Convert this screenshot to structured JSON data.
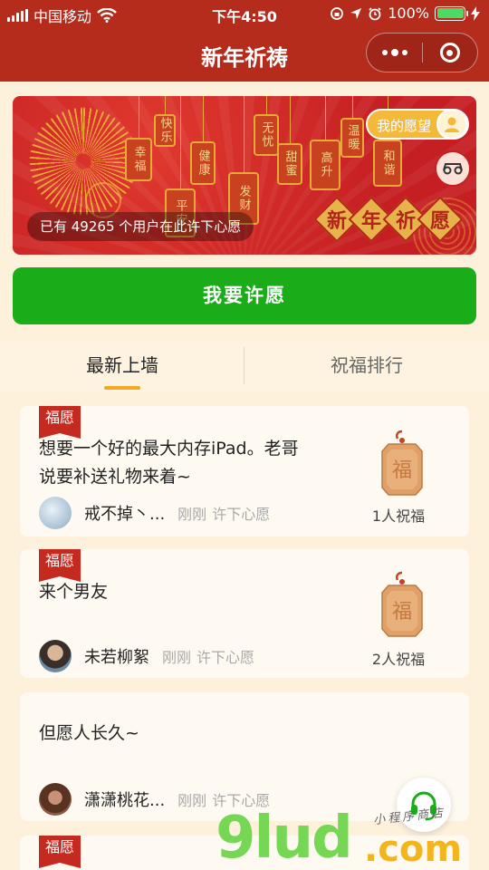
{
  "status_bar": {
    "carrier": "中国移动",
    "time": "下午4:50",
    "battery_percent": "100%",
    "battery_level": 1.0
  },
  "nav": {
    "title": "新年祈祷"
  },
  "banner": {
    "tags": [
      "快乐",
      "幸福",
      "健康",
      "平安",
      "发财",
      "无忧",
      "甜蜜",
      "高升",
      "温暖",
      "和谐"
    ],
    "my_wish_label": "我的愿望",
    "user_count_text": "已有 49265 个用户在此许下心愿",
    "slogan": [
      "新",
      "年",
      "祈",
      "愿"
    ]
  },
  "wish_button": {
    "label": "我要许愿"
  },
  "tabs": [
    {
      "label": "最新上墙",
      "active": true
    },
    {
      "label": "祝福排行",
      "active": false
    }
  ],
  "cards": [
    {
      "badge": "福愿",
      "text_lines": [
        "想要一个好的最大内存iPad。老哥",
        "说要补送礼物来着~"
      ],
      "username": "戒不掉丶...",
      "time": "刚刚",
      "action": "许下心愿",
      "blessings": "1人祝福"
    },
    {
      "badge": "福愿",
      "text_lines": [
        "来个男友"
      ],
      "username": "未若柳絮",
      "time": "刚刚",
      "action": "许下心愿",
      "blessings": "2人祝福"
    },
    {
      "badge": "",
      "text_lines": [
        "但愿人长久~"
      ],
      "username": "潇潇桃花...",
      "time": "刚刚",
      "action": "许下心愿",
      "blessings": ""
    },
    {
      "badge": "福愿"
    }
  ],
  "plaque_char": "福",
  "watermark": {
    "main": "9lud",
    "dot_com": ".com",
    "subtitle": "小程序商店"
  },
  "colors": {
    "nav_red": "#b52b1c",
    "primary_green": "#1aad19",
    "tab_indicator": "#f2a922",
    "badge_red": "#c52a21",
    "page_bg": "#fdf1dc"
  }
}
